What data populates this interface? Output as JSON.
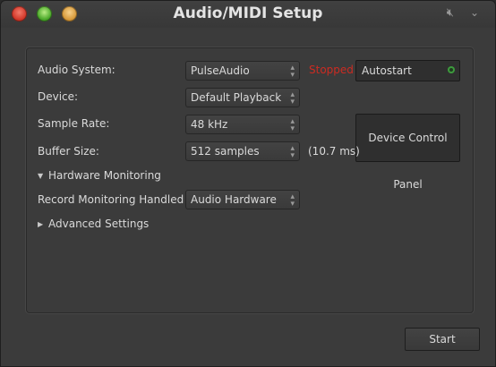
{
  "window": {
    "title": "Audio/MIDI Setup"
  },
  "titlebar_icons": {
    "mute": "speaker-mute-icon",
    "menu": "chevron-down-icon"
  },
  "form": {
    "audio_system": {
      "label": "Audio System:",
      "value": "PulseAudio"
    },
    "device": {
      "label": "Device:",
      "value": "Default Playback"
    },
    "sample_rate": {
      "label": "Sample Rate:",
      "value": "48 kHz"
    },
    "buffer_size": {
      "label": "Buffer Size:",
      "value": "512 samples",
      "latency": "(10.7 ms)"
    },
    "hardware_monitoring": {
      "label": "Hardware Monitoring",
      "expanded": true
    },
    "record_monitoring": {
      "label": "Record Monitoring Handled by:",
      "value": "Audio Hardware"
    },
    "advanced_settings": {
      "label": "Advanced Settings",
      "expanded": false
    }
  },
  "engine": {
    "status": "Stopped",
    "status_color": "#cc2b22",
    "autostart_label": "Autostart",
    "device_control_panel_label": "Device Control Panel"
  },
  "footer": {
    "start_label": "Start"
  }
}
